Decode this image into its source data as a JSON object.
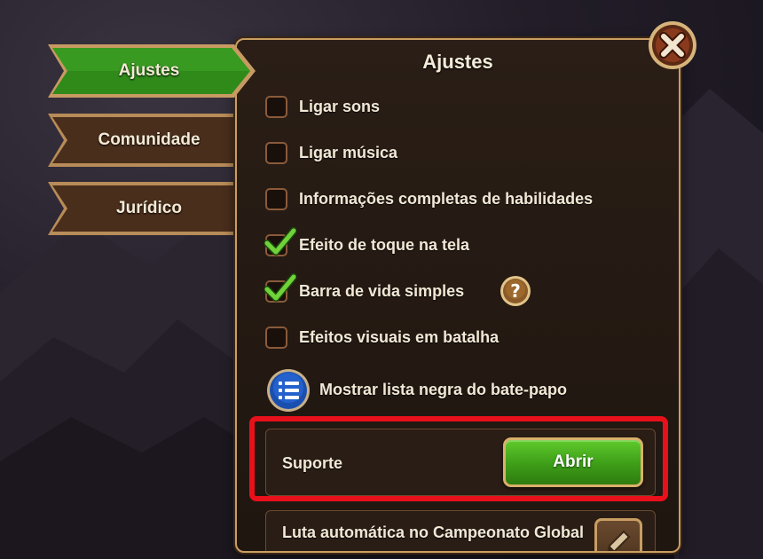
{
  "sidebar": {
    "tabs": [
      {
        "label": "Ajustes",
        "active": true
      },
      {
        "label": "Comunidade",
        "active": false
      },
      {
        "label": "Jurídico",
        "active": false
      }
    ]
  },
  "panel": {
    "title": "Ajustes",
    "options": [
      {
        "label": "Ligar sons",
        "checked": false
      },
      {
        "label": "Ligar música",
        "checked": false
      },
      {
        "label": "Informações completas de habilidades",
        "checked": false
      },
      {
        "label": "Efeito de toque na tela",
        "checked": true
      },
      {
        "label": "Barra de vida simples",
        "checked": true
      },
      {
        "label": "Efeitos visuais em batalha",
        "checked": false
      }
    ],
    "blacklist_label": "Mostrar lista negra do bate-papo",
    "support": {
      "label": "Suporte",
      "button_label": "Abrir"
    },
    "auto_fight_label": "Luta automática no Campeonato Global"
  },
  "icons": {
    "close": "close-x-icon",
    "help": "question-mark-icon",
    "list": "list-icon",
    "edit": "pencil-icon",
    "check": "checkmark-icon"
  },
  "colors": {
    "active_tab": "#2f8a1a",
    "inactive_tab": "#4a2e1c",
    "highlight": "#e8101a",
    "open_button": "#3d9d18",
    "panel_border": "#c99e62"
  }
}
